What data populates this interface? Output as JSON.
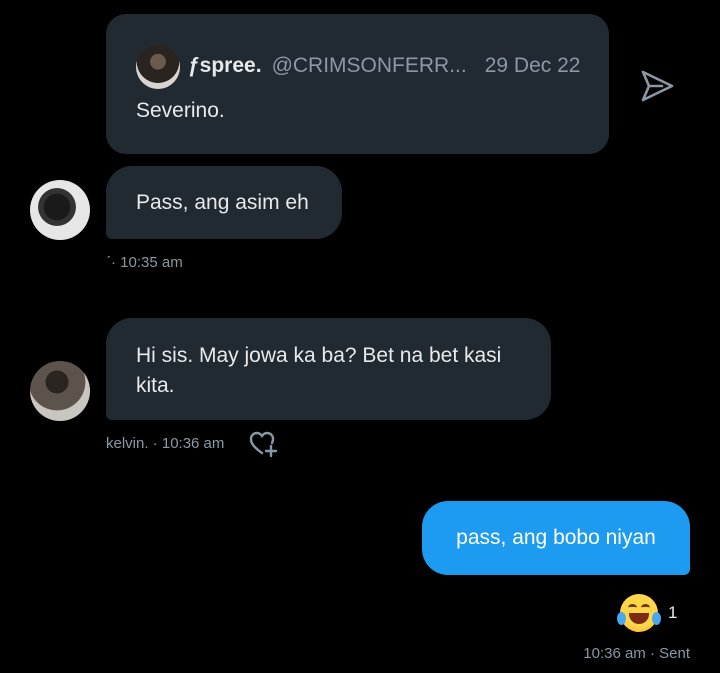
{
  "quoted_tweet": {
    "name": "ƒspree.",
    "handle": "@CRIMSONFERR...",
    "date": "29 Dec 22",
    "text": "Severino."
  },
  "icons": {
    "share": "send-icon",
    "react": "heart-plus-icon",
    "reaction_emoji": "face-with-tears-of-joy"
  },
  "messages": [
    {
      "text": "Pass, ang asim eh",
      "meta": "ˊ· 10:35 am"
    },
    {
      "text": "Hi sis. May jowa ka ba? Bet na bet kasi kita.",
      "meta": "kelvin. · 10:36 am"
    }
  ],
  "sent_message": {
    "text": "pass, ang bobo niyan",
    "reaction_count": "1",
    "meta": "10:36 am · Sent"
  },
  "colors": {
    "background": "#000000",
    "incoming_bubble": "#222a31",
    "outgoing_bubble": "#1d9bf0",
    "secondary_text": "#8b98a5"
  }
}
